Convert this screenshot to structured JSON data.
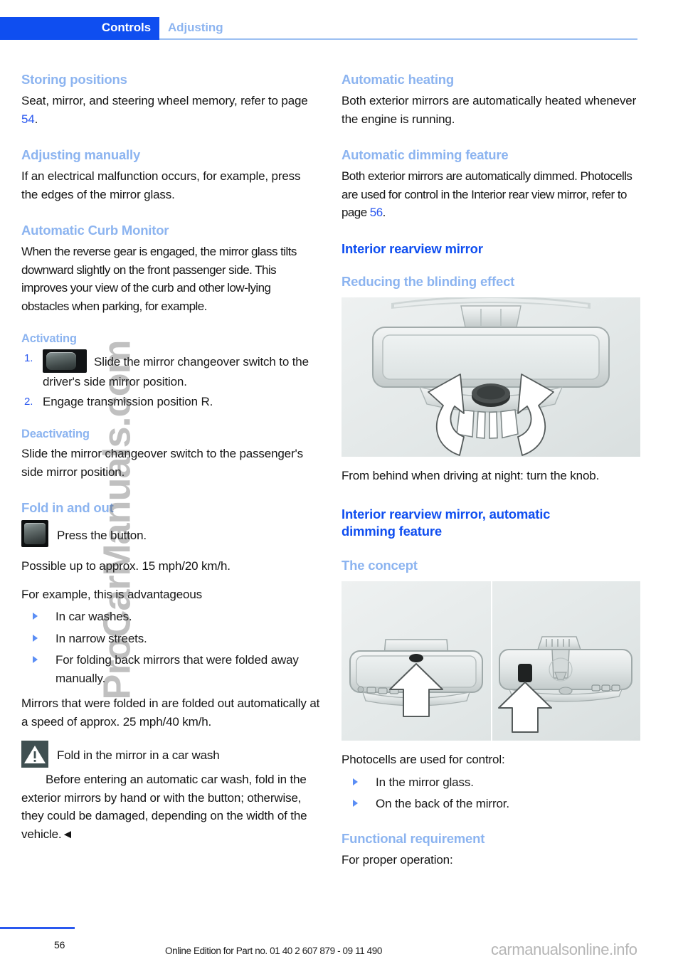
{
  "header": {
    "tab_active": "Controls",
    "tab_sub": "Adjusting"
  },
  "left_column": {
    "storing_positions": {
      "heading": "Storing positions",
      "body_before": "Seat, mirror, and steering wheel memory, refer to page ",
      "page_link": "54",
      "body_after": "."
    },
    "adjusting_manually": {
      "heading": "Adjusting manually",
      "body": "If an electrical malfunction occurs, for example, press the edges of the mirror glass."
    },
    "automatic_curb_monitor": {
      "heading": "Automatic Curb Monitor",
      "body": "When the reverse gear is engaged, the mirror glass tilts downward slightly on the front passenger side. This improves your view of the curb and other low-lying obstacles when parking, for example."
    },
    "activating": {
      "heading": "Activating",
      "steps": [
        {
          "num": "1.",
          "icon": "mirror-changeover-switch-icon",
          "text": "Slide the mirror changeover switch to the driver's side mirror position."
        },
        {
          "num": "2.",
          "text": "Engage transmission position R."
        }
      ]
    },
    "deactivating": {
      "heading": "Deactivating",
      "body": "Slide the mirror changeover switch to the passenger's side mirror position."
    },
    "fold_in_and_out": {
      "heading": "Fold in and out",
      "icon": "fold-button-icon",
      "icon_text": "Press the button.",
      "body1": "Possible up to approx. 15 mph/20 km/h.",
      "body2": "For example, this is advantageous",
      "bullets": [
        "In car washes.",
        "In narrow streets.",
        "For folding back mirrors that were folded away manually."
      ],
      "body3": "Mirrors that were folded in are folded out automatically at a speed of approx. 25 mph/40 km/h."
    },
    "warning": {
      "icon": "warning-triangle-icon",
      "title": "Fold in the mirror in a car wash",
      "body": "Before entering an automatic car wash, fold in the exterior mirrors by hand or with the button; otherwise, they could be damaged, depending on the width of the vehicle.◄"
    }
  },
  "right_column": {
    "automatic_heating": {
      "heading": "Automatic heating",
      "body": "Both exterior mirrors are automatically heated whenever the engine is running."
    },
    "automatic_dimming_feature": {
      "heading": "Automatic dimming feature",
      "body_before": "Both exterior mirrors are automatically dimmed. Photocells are used for control in the Interior rear view mirror, refer to page ",
      "page_link": "56",
      "body_after": "."
    },
    "interior_rearview_mirror": {
      "heading": "Interior rearview mirror",
      "sub_heading": "Reducing the blinding effect",
      "figure_alt": "interior-rearview-mirror-knob-figure",
      "caption": "From behind when driving at night: turn the knob."
    },
    "interior_auto_dimming": {
      "heading": "Interior rearview mirror, automatic dimming feature",
      "sub_heading": "The concept",
      "figure_alt": "photocell-locations-figure",
      "lead": "Photocells are used for control:",
      "bullets": [
        "In the mirror glass.",
        "On the back of the mirror."
      ]
    },
    "functional_requirement": {
      "heading": "Functional requirement",
      "body": "For proper operation:"
    }
  },
  "footer": {
    "page_number": "56",
    "edition_text": "Online Edition for Part no. 01 40 2 607 879 - 09 11 490"
  },
  "watermarks": {
    "vertical": "ProCarManuals.com",
    "footer": "carmanualsonline.info"
  },
  "colors": {
    "accent_blue": "#0f4ef0",
    "light_blue": "#8cb4f0",
    "link_blue": "#2a58ef"
  }
}
